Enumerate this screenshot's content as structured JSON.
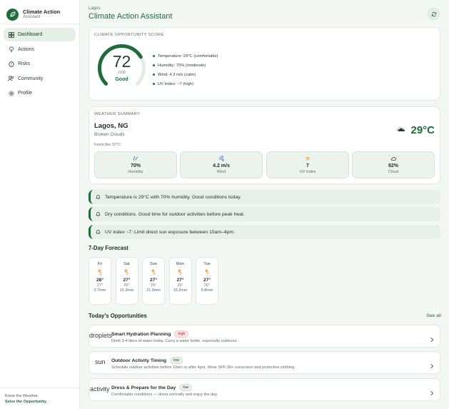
{
  "brand": {
    "title": "Climate Action",
    "subtitle": "Assistant"
  },
  "nav": [
    {
      "label": "Dashboard",
      "icon": "dashboard-icon",
      "active": true
    },
    {
      "label": "Actions",
      "icon": "lightbulb-icon"
    },
    {
      "label": "Risks",
      "icon": "alert-icon"
    },
    {
      "label": "Community",
      "icon": "users-icon"
    },
    {
      "label": "Profile",
      "icon": "gear-icon"
    }
  ],
  "footer": {
    "line1": "Know the Weather.",
    "line2": "Seize the Opportunity."
  },
  "header": {
    "location": "Lagos",
    "title": "Climate Action Assistant"
  },
  "score": {
    "label": "CLIMATE OPPORTUNITY SCORE",
    "value": "72",
    "value_fraction": 0.72,
    "max": "/100",
    "rating": "Good",
    "facts": [
      "Temperature: 29°C (comfortable)",
      "Humidity: 70% (moderate)",
      "Wind: 4.2 m/s (calm)",
      "UV Index: ~7 (high)"
    ]
  },
  "weather": {
    "label": "WEATHER SUMMARY",
    "city": "Lagos, NG",
    "condition": "Broken Clouds",
    "feels_like": "Feels like 32°C",
    "temp": "29°C",
    "stats": [
      {
        "value": "70%",
        "label": "Humidity",
        "icon": "droplet-icon"
      },
      {
        "value": "4.2 m/s",
        "label": "Wind",
        "icon": "wind-icon"
      },
      {
        "value": "7",
        "label": "UV Index",
        "icon": "sun-icon"
      },
      {
        "value": "82%",
        "label": "Cloud",
        "icon": "cloud-icon"
      }
    ]
  },
  "alerts": [
    "Temperature is 29°C with 70% humidity. Good conditions today.",
    "Dry conditions. Good time for outdoor activities before peak heat.",
    "UV index ~7: Limit direct sun exposure between 10am–4pm."
  ],
  "forecast": {
    "title": "7-Day Forecast",
    "days": [
      {
        "name": "Fri",
        "hi": "28°",
        "lo": "27°",
        "rain": "2.7mm"
      },
      {
        "name": "Sat",
        "hi": "27°",
        "lo": "26°",
        "rain": "15.3mm"
      },
      {
        "name": "Sun",
        "hi": "27°",
        "lo": "25°",
        "rain": "21.9mm"
      },
      {
        "name": "Mon",
        "hi": "27°",
        "lo": "25°",
        "rain": "15.2mm"
      },
      {
        "name": "Tue",
        "hi": "27°",
        "lo": "26°",
        "rain": "5.8mm"
      }
    ]
  },
  "opportunities": {
    "title": "Today's Opportunities",
    "see_all": "See all",
    "items": [
      {
        "icon_text": "droplets",
        "title": "Smart Hydration Planning",
        "badge": "high",
        "desc": "Drink 3-4 liters of water today. Carry a water bottle, especially outdoors."
      },
      {
        "icon_text": "sun",
        "title": "Outdoor Activity Timing",
        "badge": "low",
        "desc": "Schedule outdoor activities before 10am or after 4pm. Wear SPF 30+ sunscreen and protective clothing."
      },
      {
        "icon_text": "activity",
        "title": "Dress & Prepare for the Day",
        "badge": "low",
        "desc": "Comfortable conditions — dress normally and enjoy the day."
      }
    ]
  },
  "colors": {
    "accent": "#1f6b3a",
    "background": "#f3f7f3",
    "alert_bg": "#e7f0e8",
    "high_badge": "#b3261e",
    "rain_text": "#2f6ea8"
  }
}
